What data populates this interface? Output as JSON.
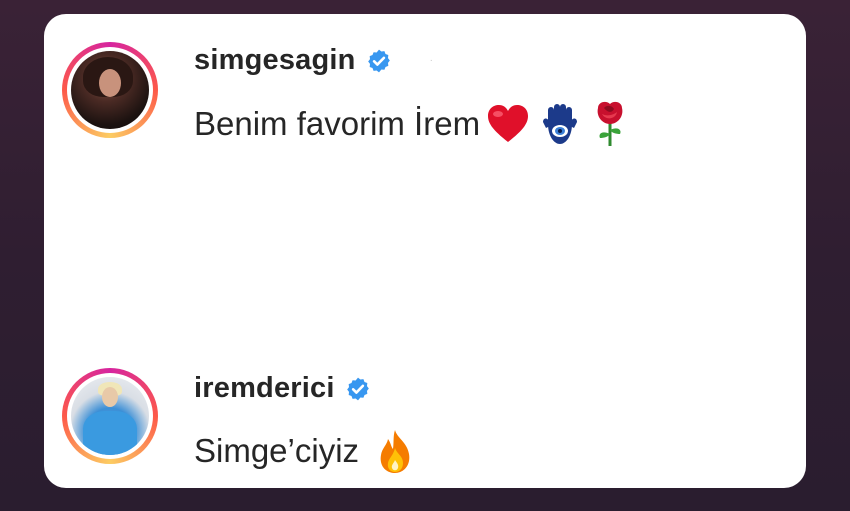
{
  "comments": [
    {
      "username": "simgesagin",
      "verified": true,
      "text": "Benim favorim İrem",
      "emojis": [
        "red-heart-icon",
        "hamsa-icon",
        "rose-icon"
      ],
      "avatar": "avatar-simgesagin"
    },
    {
      "username": "iremderici",
      "verified": true,
      "text": "Simge’ciyiz",
      "emojis": [
        "fire-icon"
      ],
      "avatar": "avatar-iremderici"
    }
  ],
  "colors": {
    "background": "#2f1e31",
    "card": "#ffffff",
    "text": "#262626",
    "verified_badge": "#3897f0"
  }
}
